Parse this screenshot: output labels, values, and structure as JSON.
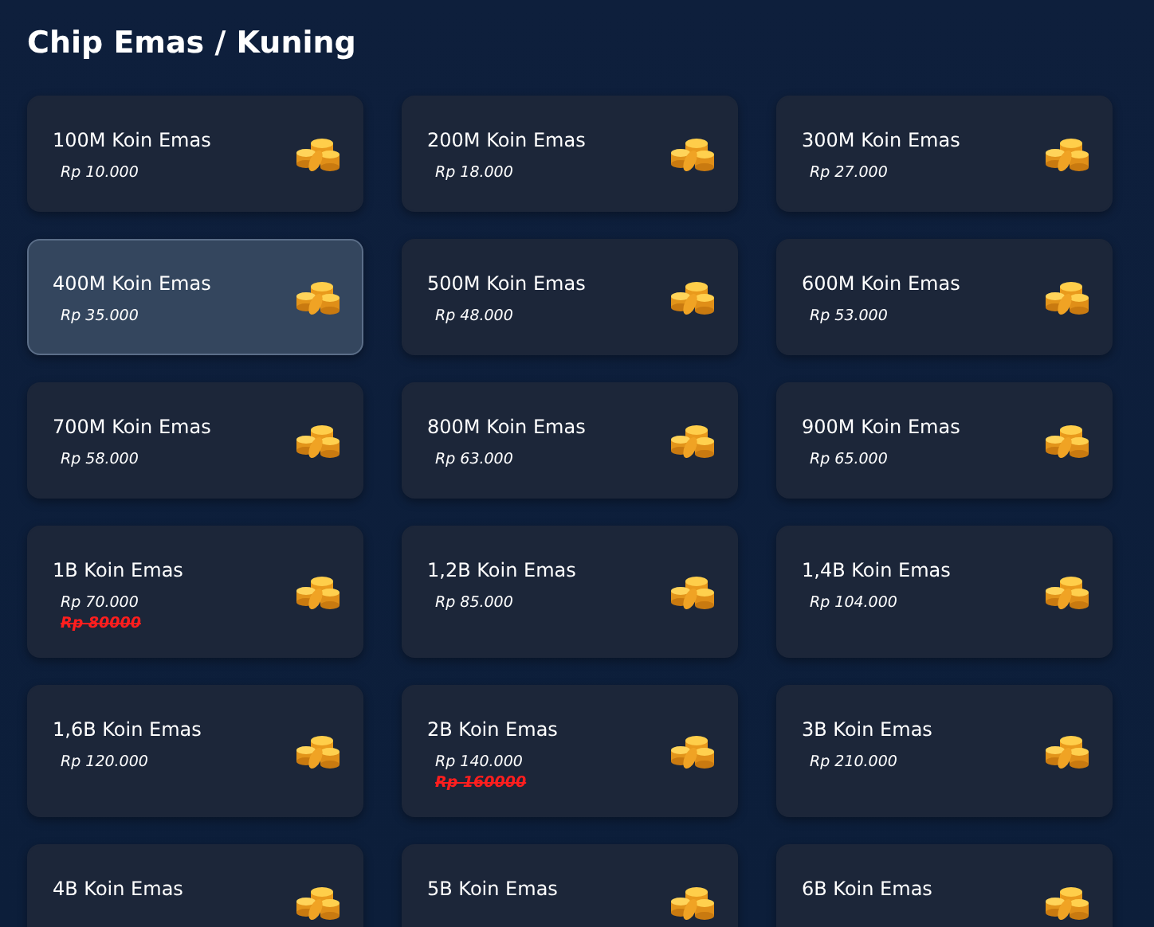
{
  "title": "Chip Emas / Kuning",
  "items": [
    {
      "name": "100M Koin Emas",
      "price": "Rp 10.000",
      "selected": false
    },
    {
      "name": "200M Koin Emas",
      "price": "Rp 18.000",
      "selected": false
    },
    {
      "name": "300M Koin Emas",
      "price": "Rp 27.000",
      "selected": false
    },
    {
      "name": "400M Koin Emas",
      "price": "Rp 35.000",
      "selected": true
    },
    {
      "name": "500M Koin Emas",
      "price": "Rp 48.000",
      "selected": false
    },
    {
      "name": "600M Koin Emas",
      "price": "Rp 53.000",
      "selected": false
    },
    {
      "name": "700M Koin Emas",
      "price": "Rp 58.000",
      "selected": false
    },
    {
      "name": "800M Koin Emas",
      "price": "Rp 63.000",
      "selected": false
    },
    {
      "name": "900M Koin Emas",
      "price": "Rp 65.000",
      "selected": false
    },
    {
      "name": "1B Koin Emas",
      "price": "Rp 70.000",
      "old_price": "Rp 80000",
      "selected": false
    },
    {
      "name": "1,2B Koin Emas",
      "price": "Rp 85.000",
      "selected": false
    },
    {
      "name": "1,4B Koin Emas",
      "price": "Rp 104.000",
      "selected": false
    },
    {
      "name": "1,6B Koin Emas",
      "price": "Rp 120.000",
      "selected": false
    },
    {
      "name": "2B Koin Emas",
      "price": "Rp 140.000",
      "old_price": "Rp 160000",
      "selected": false
    },
    {
      "name": "3B Koin Emas",
      "price": "Rp 210.000",
      "selected": false
    },
    {
      "name": "4B Koin Emas",
      "selected": false
    },
    {
      "name": "5B Koin Emas",
      "selected": false
    },
    {
      "name": "6B Koin Emas",
      "selected": false
    }
  ]
}
